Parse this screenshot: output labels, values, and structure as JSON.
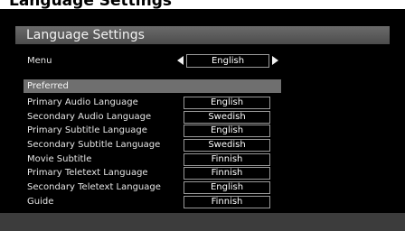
{
  "page": {
    "top_text": "Language Settings"
  },
  "header": {
    "title": "Language Settings"
  },
  "menu": {
    "label": "Menu",
    "value": "English"
  },
  "preferred": {
    "section_label": "Preferred",
    "items": [
      {
        "label": "Primary Audio Language",
        "value": "English"
      },
      {
        "label": "Secondary Audio Language",
        "value": "Swedish"
      },
      {
        "label": "Primary Subtitle Language",
        "value": "English"
      },
      {
        "label": "Secondary Subtitle Language",
        "value": "Swedish"
      },
      {
        "label": "Movie Subtitle",
        "value": "Finnish"
      },
      {
        "label": "Primary Teletext Language",
        "value": "Finnish"
      },
      {
        "label": "Secondary Teletext Language",
        "value": "English"
      },
      {
        "label": "Guide",
        "value": "Finnish"
      }
    ]
  },
  "colors": {
    "background": "#000000",
    "header_bar": "#5a5a5a",
    "section_bar": "#6f6f6f",
    "text": "#e8e8e8",
    "value_border": "#9a9a9a"
  }
}
